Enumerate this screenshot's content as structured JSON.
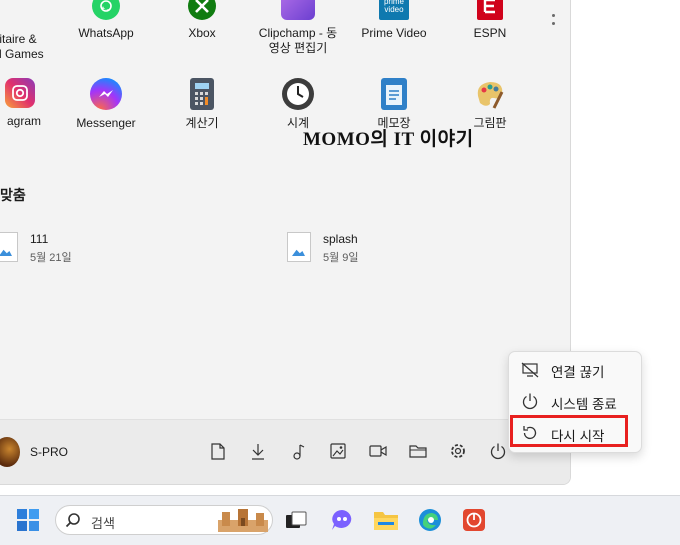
{
  "pinned_apps": [
    {
      "label": "itaire &\nal Games",
      "icon": "solitaire-icon"
    },
    {
      "label": "WhatsApp",
      "icon": "whatsapp-icon"
    },
    {
      "label": "Xbox",
      "icon": "xbox-icon"
    },
    {
      "label": "Clipchamp - 동\n영상 편집기",
      "icon": "clipchamp-icon"
    },
    {
      "label": "Prime Video",
      "icon": "prime-video-icon",
      "badge": "prime\nvideo"
    },
    {
      "label": "ESPN",
      "icon": "espn-icon"
    },
    {
      "label": "agram",
      "icon": "instagram-icon"
    },
    {
      "label": "Messenger",
      "icon": "messenger-icon"
    },
    {
      "label": "계산기",
      "icon": "calculator-icon"
    },
    {
      "label": "시계",
      "icon": "clock-icon"
    },
    {
      "label": "메모장",
      "icon": "notepad-icon"
    },
    {
      "label": "그림판",
      "icon": "paint-icon"
    }
  ],
  "watermark": "MOMO의 IT 이야기",
  "recommended": {
    "title": "맞춤",
    "items": [
      {
        "name": "111",
        "date": "5월 21일"
      },
      {
        "name": "splash",
        "date": "5월 9일"
      }
    ]
  },
  "user": {
    "name": "S-PRO"
  },
  "bottom_icons": [
    "document-icon",
    "download-icon",
    "music-icon",
    "pictures-icon",
    "video-icon",
    "folder-icon",
    "settings-icon",
    "power-icon"
  ],
  "power_menu": {
    "items": [
      {
        "label": "연결 끊기",
        "icon": "disconnect-icon"
      },
      {
        "label": "시스템 종료",
        "icon": "power-icon"
      },
      {
        "label": "다시 시작",
        "icon": "restart-icon",
        "highlighted": true
      }
    ],
    "highlight_color": "#e8201f"
  },
  "taskbar": {
    "search_placeholder": "검색",
    "apps": [
      "start-icon",
      "task-view-icon",
      "teams-chat-icon",
      "file-explorer-icon",
      "edge-icon",
      "app-icon"
    ]
  }
}
